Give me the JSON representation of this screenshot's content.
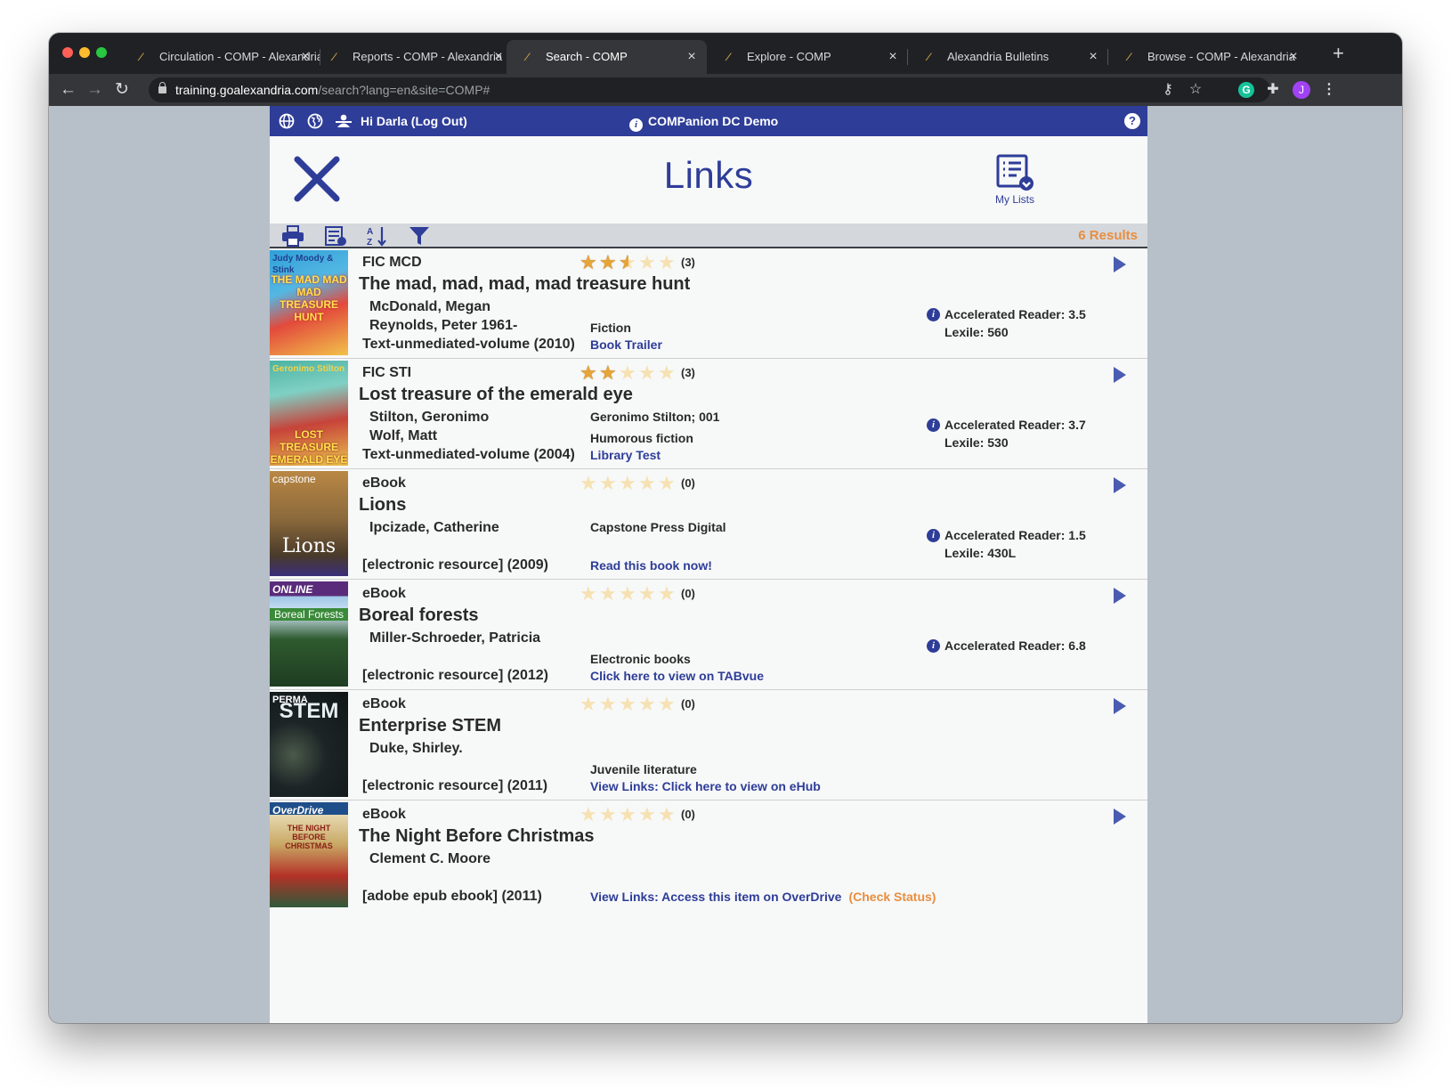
{
  "browser": {
    "tabs": [
      {
        "label": "Circulation - COMP - Alexandria"
      },
      {
        "label": "Reports - COMP - Alexandria"
      },
      {
        "label": "Search - COMP"
      },
      {
        "label": "Explore - COMP"
      },
      {
        "label": "Alexandria Bulletins"
      },
      {
        "label": "Browse - COMP - Alexandria"
      }
    ],
    "url_host": "training.goalexandria.com",
    "url_path": "/search?lang=en&site=COMP#",
    "profile_initial": "J",
    "grammarly_initial": "G"
  },
  "appbar": {
    "greeting": "Hi Darla (Log Out)",
    "site_name": "COMPanion DC Demo"
  },
  "header": {
    "title": "Links",
    "my_lists_label": "My Lists"
  },
  "results_count": "6 Results",
  "colors": {
    "brand_blue": "#2e3d98",
    "accent_orange": "#e98e3f",
    "star_fill": "#e7a437"
  },
  "results": [
    {
      "call": "FIC MCD",
      "title": "The mad, mad, mad, mad treasure hunt",
      "authors": [
        "McDonald, Megan",
        "Reynolds, Peter 1961-"
      ],
      "pub": "Text-unmediated-volume (2010)",
      "rating": 2.5,
      "count": "(3)",
      "series": "",
      "genre": "Fiction",
      "link": "Book Trailer",
      "check": "",
      "ar": "Accelerated Reader: 3.5",
      "lexile": "Lexile: 560",
      "cover_label": "Judy Moody & Stink",
      "cover_title": "THE MAD MAD MAD TREASURE HUNT"
    },
    {
      "call": "FIC STI",
      "title": "Lost treasure of the emerald eye",
      "authors": [
        "Stilton, Geronimo",
        "Wolf, Matt"
      ],
      "pub": "Text-unmediated-volume (2004)",
      "rating": 2,
      "count": "(3)",
      "series": "Geronimo Stilton; 001",
      "genre": "Humorous fiction",
      "link": "Library Test",
      "check": "",
      "ar": "Accelerated Reader: 3.7",
      "lexile": "Lexile: 530",
      "cover_label": "Geronimo Stilton",
      "cover_title": "LOST TREASURE EMERALD EYE"
    },
    {
      "call": "eBook",
      "title": "Lions",
      "authors": [
        "Ipcizade, Catherine"
      ],
      "pub": "[electronic resource] (2009)",
      "rating": 0,
      "count": "(0)",
      "series": "Capstone Press Digital",
      "genre": "",
      "link": "Read this book now!",
      "check": "",
      "ar": "Accelerated Reader: 1.5",
      "lexile": "Lexile: 430L",
      "cover_label": "capstone",
      "cover_title": "Lions"
    },
    {
      "call": "eBook",
      "title": "Boreal forests",
      "authors": [
        "Miller-Schroeder, Patricia"
      ],
      "pub": "[electronic resource] (2012)",
      "rating": 0,
      "count": "(0)",
      "series": "",
      "genre": "Electronic books",
      "link": "Click here to view on TABvue",
      "check": "",
      "ar": "Accelerated Reader: 6.8",
      "lexile": "",
      "cover_label": "ONLINE",
      "cover_title": "Boreal Forests"
    },
    {
      "call": "eBook",
      "title": "Enterprise STEM",
      "authors": [
        "Duke, Shirley."
      ],
      "pub": "[electronic resource] (2011)",
      "rating": 0,
      "count": "(0)",
      "series": "",
      "genre": "Juvenile literature",
      "link": "View Links: Click here to view on eHub",
      "check": "",
      "ar": "",
      "lexile": "",
      "cover_label": "PERMA",
      "cover_title": "STEM"
    },
    {
      "call": "eBook",
      "title": "The Night Before Christmas",
      "authors": [
        "Clement C. Moore"
      ],
      "pub": "[adobe epub ebook] (2011)",
      "rating": 0,
      "count": "(0)",
      "series": "",
      "genre": "",
      "link": "View Links: Access this item on OverDrive",
      "check": "(Check Status)",
      "ar": "",
      "lexile": "",
      "cover_label": "OverDrive",
      "cover_title": "THE NIGHT BEFORE CHRISTMAS"
    }
  ]
}
